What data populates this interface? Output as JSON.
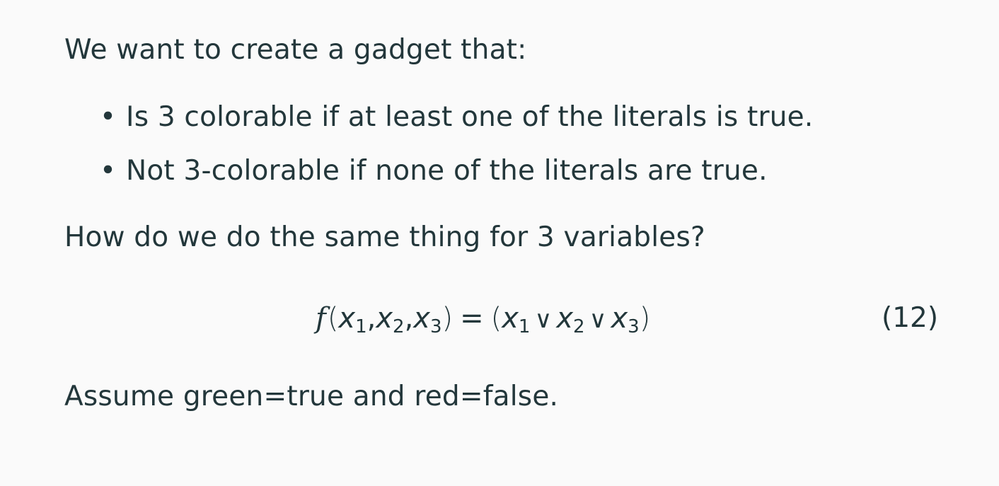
{
  "paragraphs": {
    "intro": "We want to create a gadget that:",
    "question": "How do we do the same thing for 3 variables?",
    "assumption": "Assume green=true and red=false."
  },
  "bullets": [
    "Is 3 colorable if at least one of the literals is true.",
    "Not 3-colorable if none of the literals are true."
  ],
  "bullet_symbol": "•",
  "equation": {
    "function": "f",
    "open_paren": "(",
    "close_paren": ")",
    "comma": ",",
    "equals": "=",
    "or_symbol": "∨",
    "variable": "x",
    "subscripts": [
      "1",
      "2",
      "3"
    ],
    "number": "(12)"
  },
  "colors": {
    "background": "#fafafa",
    "text": "#23373b"
  }
}
